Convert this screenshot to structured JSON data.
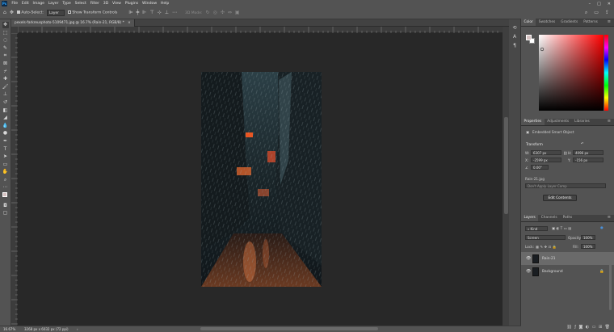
{
  "menubar": {
    "logo": "Ps",
    "items": [
      "File",
      "Edit",
      "Image",
      "Layer",
      "Type",
      "Select",
      "Filter",
      "3D",
      "View",
      "Plugins",
      "Window",
      "Help"
    ]
  },
  "options_bar": {
    "auto_select_label": "Auto-Select:",
    "auto_select_target": "Layer",
    "show_transform_label": "Show Transform Controls",
    "mode_3d_label": "3D Mode:"
  },
  "document": {
    "tab_title": "pexels-farkreusphoto-5109471.jpg @ 16.7% (Rain-21, RGB/8) *",
    "zoom": "16.67%",
    "doc_size": "3268 px x 6032 px (72 ppi)"
  },
  "color_panel": {
    "tabs": [
      "Color",
      "Swatches",
      "Gradients",
      "Patterns"
    ],
    "active_tab": "Color",
    "foreground": "#d6c2c2",
    "background": "#ffffff"
  },
  "properties_panel": {
    "tabs": [
      "Properties",
      "Adjustments",
      "Libraries"
    ],
    "active_tab": "Properties",
    "object_type": "Embedded Smart Object",
    "transform_label": "Transform",
    "w_label": "W:",
    "w_value": "6307 px",
    "h_label": "H:",
    "h_value": "4096 px",
    "x_label": "X:",
    "x_value": "-2599 px",
    "y_label": "Y:",
    "y_value": "-156 px",
    "angle_value": "0.00°",
    "filename": "Rain-21.jpg",
    "layer_comp_placeholder": "Don't Apply Layer Comp",
    "edit_contents_button": "Edit Contents"
  },
  "layers_panel": {
    "tabs": [
      "Layers",
      "Channels",
      "Paths"
    ],
    "active_tab": "Layers",
    "filter_kind": "Kind",
    "blend_mode": "Screen",
    "opacity_label": "Opacity:",
    "opacity_value": "100%",
    "lock_label": "Lock:",
    "fill_label": "Fill:",
    "fill_value": "100%",
    "layers": [
      {
        "name": "Rain-21",
        "selected": true
      },
      {
        "name": "Background",
        "selected": false
      }
    ]
  }
}
